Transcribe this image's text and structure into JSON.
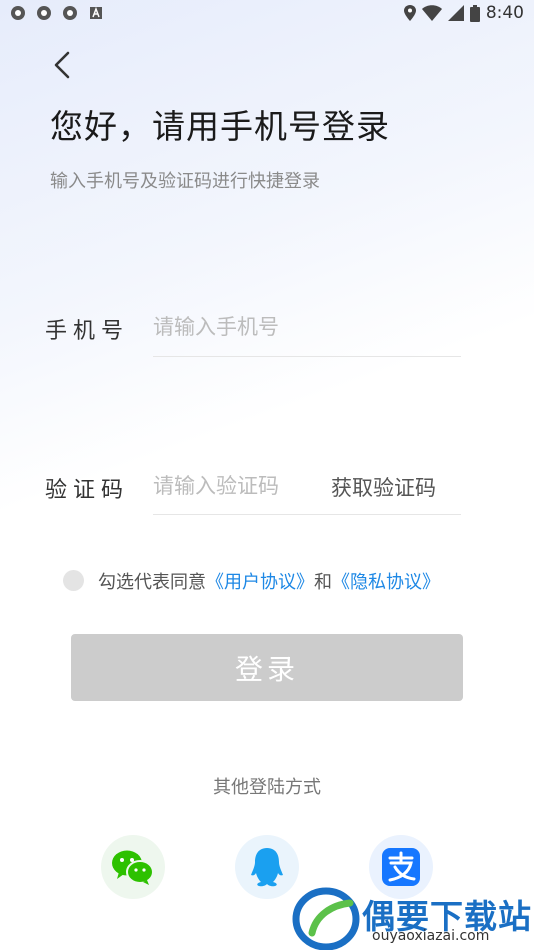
{
  "status_bar": {
    "time": "8:40"
  },
  "header": {
    "title": "您好，请用手机号登录",
    "subtitle": "输入手机号及验证码进行快捷登录"
  },
  "form": {
    "phone_label": "手机号",
    "phone_placeholder": "请输入手机号",
    "code_label": "验证码",
    "code_placeholder": "请输入验证码",
    "get_code": "获取验证码"
  },
  "agreement": {
    "prefix": "勾选代表同意",
    "user_agreement": "《用户协议》",
    "and": "和",
    "privacy_agreement": "《隐私协议》"
  },
  "login_button": "登录",
  "other_login": {
    "title": "其他登陆方式",
    "providers": [
      "wechat",
      "qq",
      "alipay"
    ]
  },
  "watermark": {
    "name": "偶要下载站",
    "url": "ouyaoxiazai.com"
  },
  "colors": {
    "link": "#1e88e5",
    "button_disabled": "#cccccc",
    "wechat": "#2dc100",
    "qq": "#1aa0f0",
    "alipay": "#1677ff"
  }
}
